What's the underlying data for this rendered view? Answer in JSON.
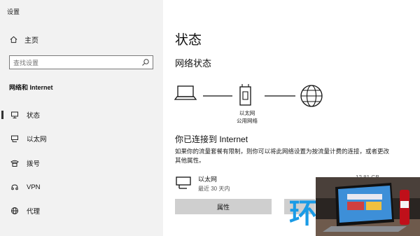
{
  "app": {
    "title": "设置"
  },
  "sidebar": {
    "home_label": "主页",
    "search_placeholder": "查找设置",
    "section_title": "网络和 Internet",
    "items": [
      {
        "label": "状态",
        "icon": "status-icon",
        "active": true
      },
      {
        "label": "以太网",
        "icon": "ethernet-icon",
        "active": false
      },
      {
        "label": "拨号",
        "icon": "dialup-icon",
        "active": false
      },
      {
        "label": "VPN",
        "icon": "vpn-icon",
        "active": false
      },
      {
        "label": "代理",
        "icon": "proxy-icon",
        "active": false
      }
    ]
  },
  "main": {
    "title": "状态",
    "network_status_title": "网络状态",
    "diagram_label_line1": "以太网",
    "diagram_label_line2": "公用网络",
    "connection_title": "你已连接到 Internet",
    "connection_desc": "如果你的流量套餐有限制，则你可以将此网络设置为按流量计费的连接，或者更改其他属性。",
    "ethernet_name": "以太网",
    "ethernet_sub": "最近 30 天内",
    "ethernet_usage": "12.81 GB",
    "properties_button": "属性"
  },
  "overlay": {
    "logo_char": "环"
  },
  "colors": {
    "sidebar_bg": "#f2f2f2",
    "button_bg": "#cfcfcf",
    "logo": "#1a9be6"
  }
}
